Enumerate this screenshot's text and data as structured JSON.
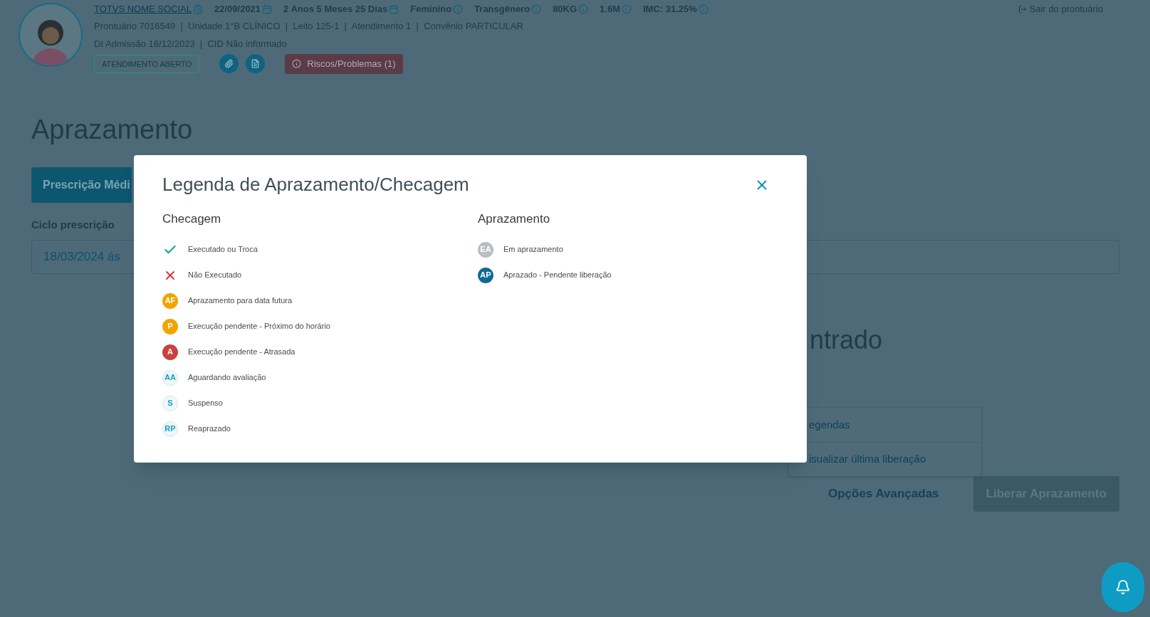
{
  "header": {
    "patient_name": "TOTVS NOME SOCIAL",
    "birth_date": "22/09/2021",
    "age": "2 Anos 5 Meses 25 Dias",
    "sex": "Feminino",
    "gender_identity": "Transgênero",
    "weight": "80KG",
    "height": "1.6M",
    "imc": "IMC: 31.25%",
    "record_line": "Prontuário 7016549  |  Unidade 1°B CLÍNICO  |  Leito 125-1  |  Atendimento 1  |  Convênio PARTICULAR",
    "admission_line": "Dt Admissão 18/12/2023  |  CID Não informado",
    "status_badge": "ATENDIMENTO ABERTO",
    "risks_button": "Riscos/Problemas (1)",
    "exit_link": "Sair do prontuário"
  },
  "page": {
    "title": "Aprazamento",
    "tab_button": "Prescrição Médi",
    "cycle_label": "Ciclo prescrição",
    "cycle_value": "18/03/2024 ás",
    "empty_message": "ntrado",
    "advanced_options": "Opções Avançadas",
    "release_button": "Liberar Aprazamento"
  },
  "menu": [
    "egendas",
    "isualizar última liberação"
  ],
  "modal": {
    "title": "Legenda de Aprazamento/Checagem",
    "sections": [
      {
        "title": "Checagem",
        "items": [
          {
            "kind": "check",
            "label": "Executado ou Troca"
          },
          {
            "kind": "cross",
            "label": "Não Executado"
          },
          {
            "kind": "solid",
            "code": "AF",
            "color": "#f0a500",
            "label": "Aprazamento para data futura"
          },
          {
            "kind": "solid",
            "code": "P",
            "color": "#f0a500",
            "label": "Execução pendente - Próximo do horário"
          },
          {
            "kind": "solid",
            "code": "A",
            "color": "#c8423f",
            "label": "Execução pendente - Atrasada"
          },
          {
            "kind": "outline",
            "code": "AA",
            "color": "#1a9bc4",
            "label": "Aguardando avaliação"
          },
          {
            "kind": "outline",
            "code": "S",
            "color": "#1a9bc4",
            "label": "Suspenso"
          },
          {
            "kind": "outline",
            "code": "RP",
            "color": "#1a9bc4",
            "label": "Reaprazado"
          }
        ]
      },
      {
        "title": "Aprazamento",
        "items": [
          {
            "kind": "solid",
            "code": "EA",
            "color": "#b9bec1",
            "label": "Em aprazamento"
          },
          {
            "kind": "solid",
            "code": "AP",
            "color": "#0f6c95",
            "label": "Aprazado - Pendente liberação"
          }
        ]
      }
    ]
  }
}
